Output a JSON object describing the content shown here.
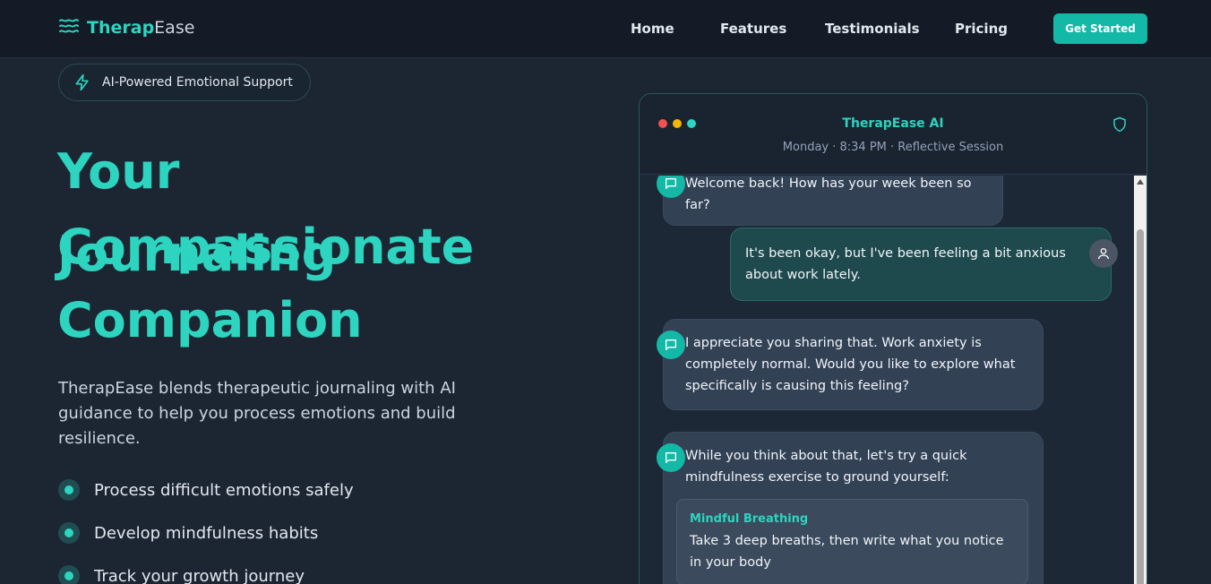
{
  "brand": {
    "name_part1": "Therap",
    "name_part2": "Ease"
  },
  "nav": {
    "items": [
      "Home",
      "Features",
      "Testimonials",
      "Pricing"
    ],
    "cta_label": "Get Started"
  },
  "hero": {
    "badge": "AI-Powered Emotional Support",
    "title_lines": [
      "Your Compassionate",
      "Journaling",
      "Companion"
    ],
    "subtitle": "TherapEase blends therapeutic journaling with AI guidance to help you process emotions and build resilience.",
    "features": [
      "Process difficult emotions safely",
      "Develop mindfulness habits",
      "Track your growth journey"
    ]
  },
  "chat": {
    "title": "TherapEase AI",
    "meta": "Monday · 8:34 PM · Reflective Session",
    "messages": [
      {
        "role": "ai",
        "text": "Welcome back! How has your week been so far?"
      },
      {
        "role": "user",
        "text": "It's been okay, but I've been feeling a bit anxious about work lately."
      },
      {
        "role": "ai",
        "text": "I appreciate you sharing that. Work anxiety is completely normal. Would you like to explore what specifically is causing this feeling?"
      },
      {
        "role": "ai",
        "text": "While you think about that, let's try a quick mindfulness exercise to ground yourself:",
        "card_title": "Mindful Breathing",
        "card_body": "Take 3 deep breaths, then write what you notice in your body"
      }
    ]
  },
  "colors": {
    "accent": "#2dd4bf",
    "background": "#1c2633",
    "topbar": "#141b26",
    "cta": "#14b8a6",
    "light_red": "#f05252",
    "light_yellow": "#f5b50b",
    "light_green": "#2dd4bf"
  },
  "icons": {
    "logo": "waves-icon",
    "badge": "lightning-icon",
    "chat_status": "shield-icon",
    "ai_avatar": "chat-bubble-icon",
    "user_avatar": "user-icon"
  }
}
